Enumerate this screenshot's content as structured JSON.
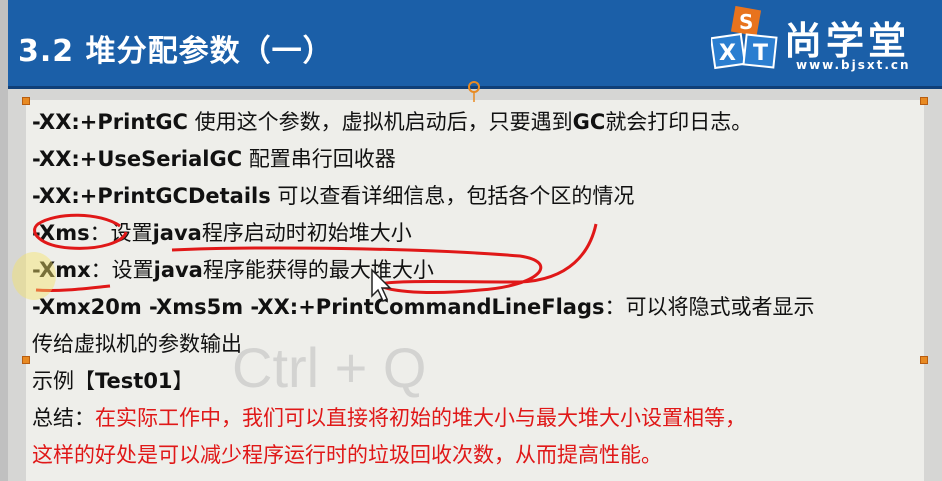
{
  "header": {
    "title": "3.2 堆分配参数（一）",
    "brand": "尚学堂",
    "url": "www.bjsxt.cn",
    "logo_letters": [
      "S",
      "X",
      "T"
    ]
  },
  "lines": [
    {
      "opt": "-XX:+PrintGC",
      "desc": " 使用这个参数，虚拟机启动后，只要遇到",
      "opt2": "GC",
      "desc2": "就会打印日志。"
    },
    {
      "opt": "-XX:+UseSerialGC",
      "desc": " 配置串行回收器"
    },
    {
      "opt": "-XX:+PrintGCDetails",
      "desc": " 可以查看详细信息，包括各个区的情况"
    },
    {
      "opt": "-Xms",
      "desc": "：设置",
      "opt2": "java",
      "desc2": "程序启动时初始堆大小"
    },
    {
      "opt": "-Xmx",
      "desc": "：设置",
      "opt2": "java",
      "desc2": "程序能获得的最大堆大小"
    },
    {
      "opt": "-Xmx20m -Xms5m -XX:+PrintCommandLineFlags",
      "desc": "：可以将隐式或者显示"
    },
    {
      "opt": "",
      "desc": "传给虚拟机的参数输出"
    },
    {
      "opt": "",
      "desc": "示例【",
      "opt2": "Test01",
      "desc2": "】"
    }
  ],
  "summary": {
    "label": "总结：",
    "line1": "在实际工作中，我们可以直接将初始的堆大小与最大堆大小设置相等，",
    "line2": "这样的好处是可以减少程序运行时的垃圾回收次数，从而提高性能。"
  },
  "overlay": {
    "ghost_text": "Ctrl + Q"
  },
  "colors": {
    "header_bg": "#1b5fa8",
    "summary_red": "#e01818",
    "annotation_red": "#e01818",
    "handle_orange": "#e88a22"
  }
}
